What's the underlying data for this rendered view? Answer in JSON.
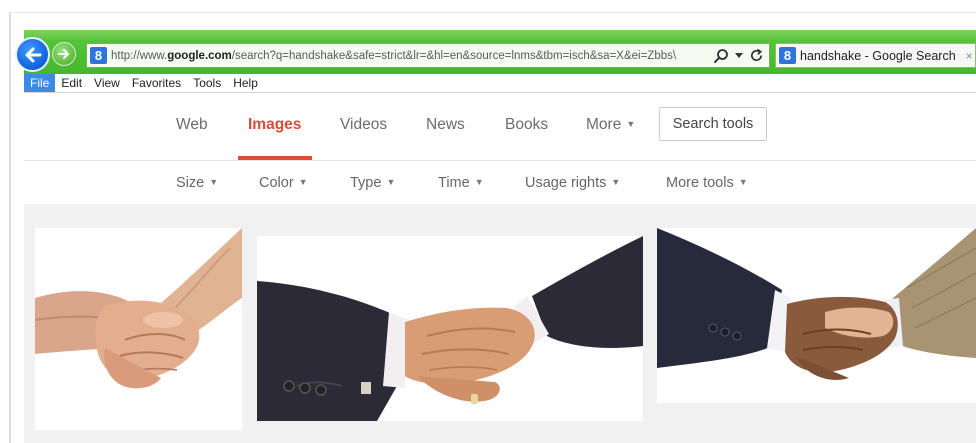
{
  "browser": {
    "url_prefix": "http://www.",
    "url_host": "google.com",
    "url_rest": "/search?q=handshake&safe=strict&lr=&hl=en&source=lnms&tbm=isch&sa=X&ei=Zbbs\\",
    "favicon_letter": "8",
    "tab_title": "handshake - Google Search",
    "tab_close": "×",
    "search_glyph": "⚲",
    "dropdown_glyph": "▾",
    "refresh_glyph": "↻"
  },
  "menubar": {
    "items": [
      "File",
      "Edit",
      "View",
      "Favorites",
      "Tools",
      "Help"
    ]
  },
  "google": {
    "tabs": [
      "Web",
      "Images",
      "Videos",
      "News",
      "Books",
      "More"
    ],
    "active_tab": "Images",
    "caret": "▼",
    "search_tools": "Search tools",
    "tools": [
      "Size",
      "Color",
      "Type",
      "Time",
      "Usage rights",
      "More tools"
    ]
  },
  "colors": {
    "chrome_green": "#4cbf33",
    "accent_red": "#dd4b39",
    "back_blue": "#1160d8",
    "results_bg": "#f1f1f1"
  },
  "results": {
    "images": [
      "handshake-image-1",
      "handshake-image-2",
      "handshake-image-3"
    ]
  }
}
